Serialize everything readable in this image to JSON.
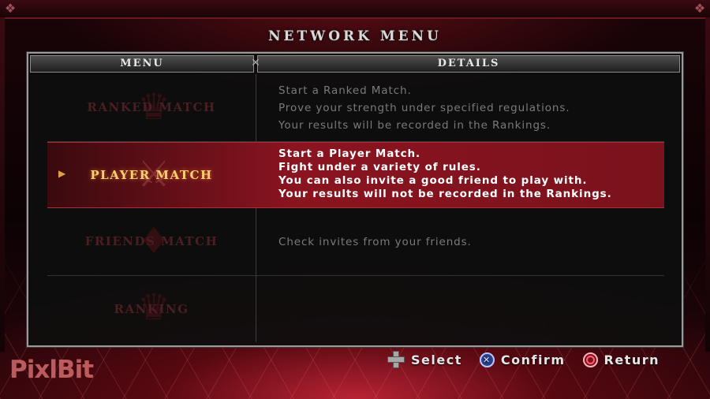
{
  "screen_title": "NETWORK MENU",
  "columns": {
    "menu": "MENU",
    "details": "DETAILS"
  },
  "menu_items": [
    {
      "label": "RANKED MATCH",
      "state": "disabled",
      "emblem_icon": "crown-controllers-icon",
      "details": [
        "Start a Ranked Match.",
        "Prove your strength under specified regulations.",
        "Your results will be recorded in the Rankings."
      ]
    },
    {
      "label": "PLAYER MATCH",
      "state": "selected",
      "emblem_icon": "fighters-silhouette-icon",
      "details": [
        "Start a Player Match.",
        "Fight under a variety of rules.",
        "You can also invite a good friend to play with.",
        "Your results will not be recorded in the Rankings."
      ]
    },
    {
      "label": "FRIENDS MATCH",
      "state": "disabled",
      "emblem_icon": "card-icon",
      "details": [
        "Check invites from your friends."
      ]
    },
    {
      "label": "RANKING",
      "state": "disabled",
      "emblem_icon": "crown-icon",
      "details": []
    }
  ],
  "button_hints": [
    {
      "icon": "dpad-icon",
      "label": "Select"
    },
    {
      "icon": "cross-button-icon",
      "label": "Confirm"
    },
    {
      "icon": "circle-button-icon",
      "label": "Return"
    }
  ],
  "watermark": "PixlBit",
  "colors": {
    "selected_row": "#8a1420",
    "selected_label": "#ffd070",
    "disabled_label": "#4a1e22",
    "detail_text": "#7a7a7a"
  }
}
